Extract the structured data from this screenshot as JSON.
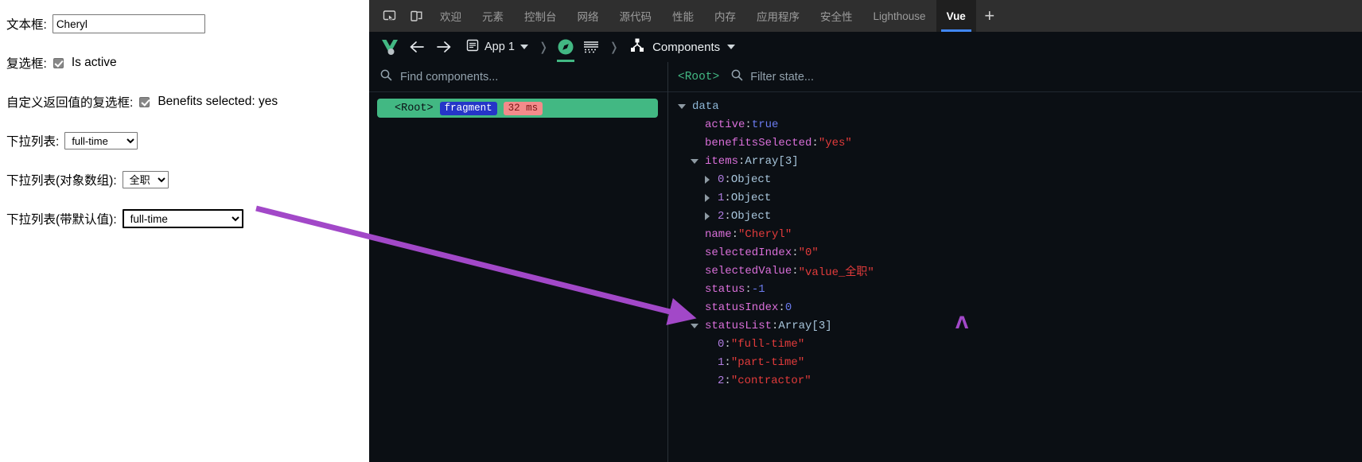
{
  "page": {
    "rows": [
      {
        "label": "文本框:",
        "type": "text",
        "value": "Cheryl"
      },
      {
        "label": "复选框:",
        "type": "checkbox",
        "checked": true,
        "text": "Is active"
      },
      {
        "label": "自定义返回值的复选框:",
        "type": "checkbox",
        "checked": true,
        "text": "Benefits selected: yes"
      },
      {
        "label": "下拉列表:",
        "type": "select",
        "value": "full-time"
      },
      {
        "label": "下拉列表(对象数组):",
        "type": "select",
        "value": "全职"
      },
      {
        "label": "下拉列表(带默认值):",
        "type": "select",
        "value": "full-time"
      }
    ]
  },
  "devtools": {
    "tabs": [
      {
        "label": "欢迎",
        "active": false
      },
      {
        "label": "元素",
        "active": false
      },
      {
        "label": "控制台",
        "active": false
      },
      {
        "label": "网络",
        "active": false
      },
      {
        "label": "源代码",
        "active": false
      },
      {
        "label": "性能",
        "active": false
      },
      {
        "label": "内存",
        "active": false
      },
      {
        "label": "应用程序",
        "active": false
      },
      {
        "label": "安全性",
        "active": false
      },
      {
        "label": "Lighthouse",
        "active": false
      },
      {
        "label": "Vue",
        "active": true
      }
    ],
    "add_tab_label": "+",
    "accent_active_tab": "#4187f5",
    "vue_green": "#42b883"
  },
  "vue_toolbar": {
    "app_label": "App 1",
    "panel_title": "Components"
  },
  "components_pane": {
    "search_placeholder": "Find components...",
    "nodes": [
      {
        "name": "<Root>",
        "tag": "fragment",
        "time": "32 ms"
      }
    ]
  },
  "state_pane": {
    "breadcrumb": "<Root>",
    "search_placeholder": "Filter state...",
    "group_label": "data",
    "entries": [
      {
        "indent": 1,
        "toggle": "none",
        "key": "active",
        "keyclass": "k",
        "value": "true",
        "valclass": "v-bool"
      },
      {
        "indent": 1,
        "toggle": "none",
        "key": "benefitsSelected",
        "keyclass": "k",
        "value": "\"yes\"",
        "valclass": "v-str"
      },
      {
        "indent": 1,
        "toggle": "open",
        "key": "items",
        "keyclass": "k",
        "value": "Array[3]",
        "valclass": "v-type"
      },
      {
        "indent": 2,
        "toggle": "closed",
        "key": "0",
        "keyclass": "k-idx",
        "value": "Object",
        "valclass": "v-type"
      },
      {
        "indent": 2,
        "toggle": "closed",
        "key": "1",
        "keyclass": "k-idx",
        "value": "Object",
        "valclass": "v-type"
      },
      {
        "indent": 2,
        "toggle": "closed",
        "key": "2",
        "keyclass": "k-idx",
        "value": "Object",
        "valclass": "v-type"
      },
      {
        "indent": 1,
        "toggle": "none",
        "key": "name",
        "keyclass": "k",
        "value": "\"Cheryl\"",
        "valclass": "v-str"
      },
      {
        "indent": 1,
        "toggle": "none",
        "key": "selectedIndex",
        "keyclass": "k",
        "value": "\"0\"",
        "valclass": "v-str"
      },
      {
        "indent": 1,
        "toggle": "none",
        "key": "selectedValue",
        "keyclass": "k",
        "value": "\"value_全职\"",
        "valclass": "v-str"
      },
      {
        "indent": 1,
        "toggle": "none",
        "key": "status",
        "keyclass": "k",
        "value": "-1",
        "valclass": "v-num"
      },
      {
        "indent": 1,
        "toggle": "none",
        "key": "statusIndex",
        "keyclass": "k",
        "value": "0",
        "valclass": "v-num"
      },
      {
        "indent": 1,
        "toggle": "open",
        "key": "statusList",
        "keyclass": "k",
        "value": "Array[3]",
        "valclass": "v-type"
      },
      {
        "indent": 2,
        "toggle": "none",
        "key": "0",
        "keyclass": "k-idx",
        "value": "\"full-time\"",
        "valclass": "v-str"
      },
      {
        "indent": 2,
        "toggle": "none",
        "key": "1",
        "keyclass": "k-idx",
        "value": "\"part-time\"",
        "valclass": "v-str"
      },
      {
        "indent": 2,
        "toggle": "none",
        "key": "2",
        "keyclass": "k-idx",
        "value": "\"contractor\"",
        "valclass": "v-str"
      }
    ]
  },
  "annotation": {
    "arrow_color": "#a248c8",
    "cursor_glyph": "Λ"
  }
}
